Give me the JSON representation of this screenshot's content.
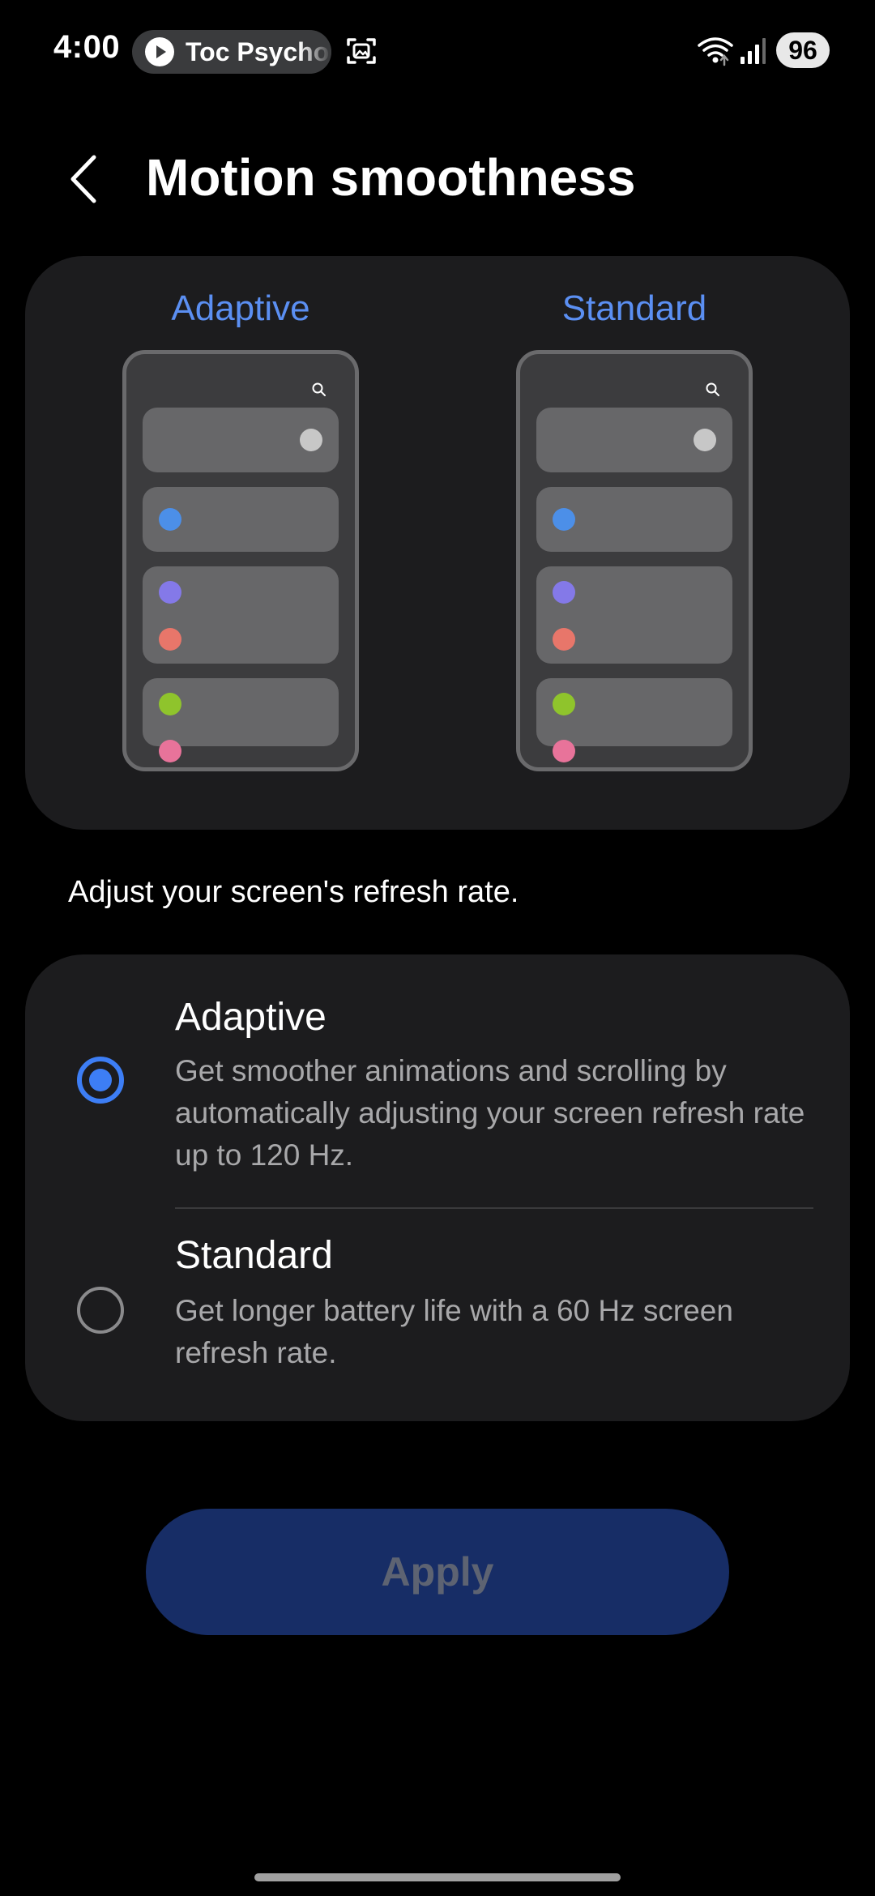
{
  "status_bar": {
    "time": "4:00",
    "media_title": "Toc Psycho",
    "battery": "96",
    "icons": [
      "play-icon",
      "screenshot-icon",
      "wifi-icon",
      "signal-icon"
    ]
  },
  "header": {
    "title": "Motion smoothness",
    "back_icon": "chevron-left-icon"
  },
  "preview": {
    "adaptive_label": "Adaptive",
    "standard_label": "Standard",
    "dot_colors": [
      "#c7c7c7",
      "#4c8fe8",
      "#8479e8",
      "#e8766a",
      "#8fc42c",
      "#e8739a"
    ]
  },
  "description": "Adjust your screen's refresh rate.",
  "options": [
    {
      "title": "Adaptive",
      "description": "Get smoother animations and scrolling by automatically adjusting your screen refresh rate up to 120 Hz.",
      "selected": true
    },
    {
      "title": "Standard",
      "description": "Get longer battery life with a 60 Hz screen refresh rate.",
      "selected": false
    }
  ],
  "apply_button": {
    "label": "Apply",
    "enabled": false
  },
  "colors": {
    "accent": "#3d7ef5",
    "label_blue": "#5b8ff2",
    "card": "#1c1c1e",
    "button_disabled": "#172d66"
  }
}
